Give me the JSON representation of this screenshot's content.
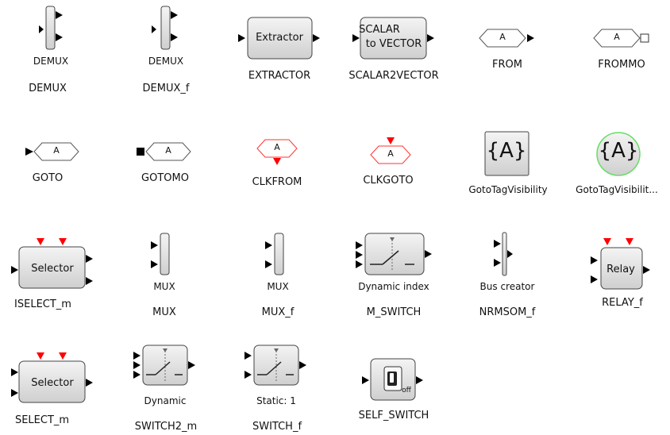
{
  "palette": {
    "block_fill_top": "#f4f4f4",
    "block_fill_bottom": "#cfcfcf",
    "block_stroke": "#444444",
    "port": "#000000",
    "clock_port": "#ff0000",
    "clock_outline": "#ff3333",
    "highlight_ring": "#66dd66"
  },
  "blocks": [
    {
      "name": "DEMUX",
      "inner_label": "DEMUX",
      "icon": "demux-icon"
    },
    {
      "name": "DEMUX_f",
      "inner_label": "DEMUX",
      "icon": "demux-icon"
    },
    {
      "name": "EXTRACTOR",
      "inner_label": "Extractor",
      "icon": "extractor-icon"
    },
    {
      "name": "SCALAR2VECTOR",
      "inner_label_line1": "SCALAR",
      "inner_label_line2": "to VECTOR",
      "icon": "scalar-to-vector-icon"
    },
    {
      "name": "FROM",
      "inner_label": "A",
      "icon": "from-tag-icon"
    },
    {
      "name": "FROMMO",
      "inner_label": "A",
      "icon": "frommo-tag-icon"
    },
    {
      "name": "GOTO",
      "inner_label": "A",
      "icon": "goto-tag-icon"
    },
    {
      "name": "GOTOMO",
      "inner_label": "A",
      "icon": "gotomo-tag-icon"
    },
    {
      "name": "CLKFROM",
      "inner_label": "A",
      "icon": "clock-from-icon"
    },
    {
      "name": "CLKGOTO",
      "inner_label": "A",
      "icon": "clock-goto-icon"
    },
    {
      "name": "GotoTagVisibility",
      "inner_label": "{A}",
      "icon": "goto-tag-visibility-icon"
    },
    {
      "name": "GotoTagVisibilit...",
      "inner_label": "{A}",
      "icon": "goto-tag-visibility-mo-icon"
    },
    {
      "name": "ISELECT_m",
      "inner_label": "Selector",
      "icon": "iselect-icon"
    },
    {
      "name": "MUX",
      "inner_label": "MUX",
      "icon": "mux-icon"
    },
    {
      "name": "MUX_f",
      "inner_label": "MUX",
      "icon": "mux-icon"
    },
    {
      "name": "M_SWITCH",
      "inner_label": "Dynamic index",
      "icon": "switch-icon"
    },
    {
      "name": "NRMSOM_f",
      "inner_label": "Bus creator",
      "icon": "bus-creator-icon"
    },
    {
      "name": "RELAY_f",
      "inner_label": "Relay",
      "icon": "relay-icon"
    },
    {
      "name": "SELECT_m",
      "inner_label": "Selector",
      "icon": "select-icon"
    },
    {
      "name": "SWITCH2_m",
      "inner_label": "Dynamic",
      "icon": "switch-icon"
    },
    {
      "name": "SWITCH_f",
      "inner_label": "Static: 1",
      "icon": "switch-icon"
    },
    {
      "name": "SELF_SWITCH",
      "inner_label": "off",
      "icon": "toggle-switch-icon"
    }
  ]
}
